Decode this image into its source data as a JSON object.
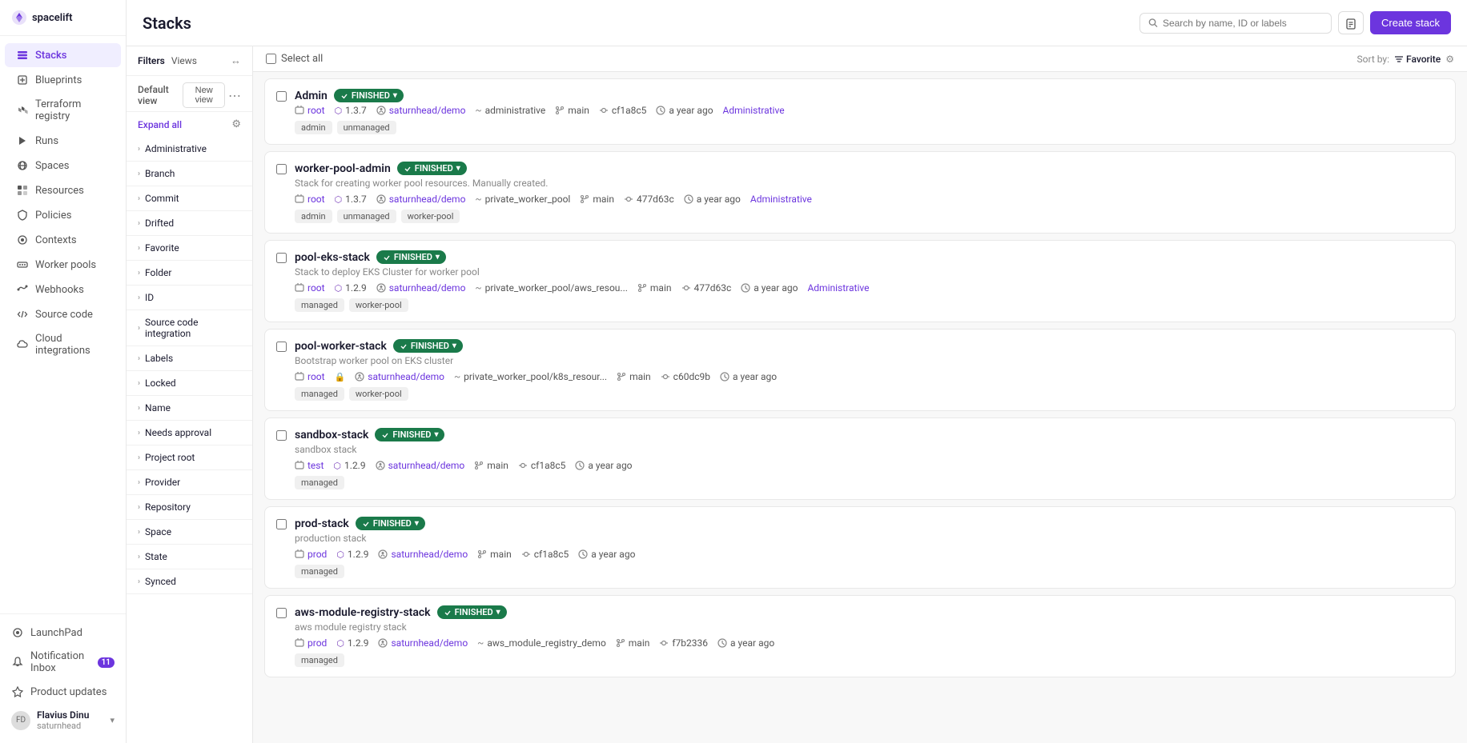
{
  "sidebar": {
    "logo": "spacelift",
    "nav_items": [
      {
        "id": "stacks",
        "label": "Stacks",
        "active": true
      },
      {
        "id": "blueprints",
        "label": "Blueprints"
      },
      {
        "id": "terraform",
        "label": "Terraform registry"
      },
      {
        "id": "runs",
        "label": "Runs"
      },
      {
        "id": "spaces",
        "label": "Spaces"
      },
      {
        "id": "resources",
        "label": "Resources"
      },
      {
        "id": "policies",
        "label": "Policies"
      },
      {
        "id": "contexts",
        "label": "Contexts"
      },
      {
        "id": "worker-pools",
        "label": "Worker pools"
      },
      {
        "id": "webhooks",
        "label": "Webhooks"
      },
      {
        "id": "source-code",
        "label": "Source code"
      },
      {
        "id": "cloud-integrations",
        "label": "Cloud integrations"
      }
    ],
    "bottom_items": [
      {
        "id": "launchpad",
        "label": "LaunchPad"
      },
      {
        "id": "notification-inbox",
        "label": "Notification Inbox",
        "badge": "11"
      },
      {
        "id": "product-updates",
        "label": "Product updates"
      }
    ],
    "user": {
      "name": "Flavius Dinu",
      "org": "saturnhead"
    }
  },
  "header": {
    "title": "Stacks",
    "search_placeholder": "Search by name, ID or labels",
    "create_button": "Create stack"
  },
  "filters": {
    "filters_label": "Filters",
    "views_label": "Views",
    "expand_all_label": "Expand all",
    "default_view": "Default view",
    "new_view_label": "New view",
    "filter_groups": [
      {
        "label": "Administrative"
      },
      {
        "label": "Branch"
      },
      {
        "label": "Commit"
      },
      {
        "label": "Drifted"
      },
      {
        "label": "Favorite"
      },
      {
        "label": "Folder"
      },
      {
        "label": "ID"
      },
      {
        "label": "Source code integration"
      },
      {
        "label": "Labels"
      },
      {
        "label": "Locked"
      },
      {
        "label": "Name"
      },
      {
        "label": "Needs approval"
      },
      {
        "label": "Project root"
      },
      {
        "label": "Provider"
      },
      {
        "label": "Repository"
      },
      {
        "label": "Space"
      },
      {
        "label": "State"
      },
      {
        "label": "Synced"
      }
    ]
  },
  "select_all": "Select all",
  "sort": {
    "label": "Sort by:",
    "value": "Favorite"
  },
  "stacks": [
    {
      "id": "admin",
      "name": "Admin",
      "description": "",
      "status": "FINISHED",
      "root": "root",
      "tf_version": "1.3.7",
      "repo": "saturnhead/demo",
      "path": "administrative",
      "branch": "main",
      "commit": "cf1a8c5",
      "time": "a year ago",
      "space": "Administrative",
      "tags": [
        "admin",
        "unmanaged"
      ]
    },
    {
      "id": "worker-pool-admin",
      "name": "worker-pool-admin",
      "description": "Stack for creating worker pool resources. Manually created.",
      "status": "FINISHED",
      "root": "root",
      "tf_version": "1.3.7",
      "repo": "saturnhead/demo",
      "path": "private_worker_pool",
      "branch": "main",
      "commit": "477d63c",
      "time": "a year ago",
      "space": "Administrative",
      "tags": [
        "admin",
        "unmanaged",
        "worker-pool"
      ]
    },
    {
      "id": "pool-eks-stack",
      "name": "pool-eks-stack",
      "description": "Stack to deploy EKS Cluster for worker pool",
      "status": "FINISHED",
      "root": "root",
      "tf_version": "1.2.9",
      "repo": "saturnhead/demo",
      "path": "private_worker_pool/aws_resou...",
      "branch": "main",
      "commit": "477d63c",
      "time": "a year ago",
      "space": "Administrative",
      "tags": [
        "managed",
        "worker-pool"
      ]
    },
    {
      "id": "pool-worker-stack",
      "name": "pool-worker-stack",
      "description": "Bootstrap worker pool on EKS cluster",
      "status": "FINISHED",
      "root": "root",
      "tf_version": "",
      "repo": "saturnhead/demo",
      "path": "private_worker_pool/k8s_resour...",
      "branch": "main",
      "commit": "c60dc9b",
      "time": "a year ago",
      "space": "",
      "tags": [
        "managed",
        "worker-pool"
      ]
    },
    {
      "id": "sandbox-stack",
      "name": "sandbox-stack",
      "description": "sandbox stack",
      "status": "FINISHED",
      "root": "test",
      "tf_version": "1.2.9",
      "repo": "saturnhead/demo",
      "path": "",
      "branch": "main",
      "commit": "cf1a8c5",
      "time": "a year ago",
      "space": "",
      "tags": [
        "managed"
      ]
    },
    {
      "id": "prod-stack",
      "name": "prod-stack",
      "description": "production stack",
      "status": "FINISHED",
      "root": "prod",
      "tf_version": "1.2.9",
      "repo": "saturnhead/demo",
      "path": "",
      "branch": "main",
      "commit": "cf1a8c5",
      "time": "a year ago",
      "space": "",
      "tags": [
        "managed"
      ]
    },
    {
      "id": "aws-module-registry-stack",
      "name": "aws-module-registry-stack",
      "description": "aws module registry stack",
      "status": "FINISHED",
      "root": "prod",
      "tf_version": "1.2.9",
      "repo": "saturnhead/demo",
      "path": "aws_module_registry_demo",
      "branch": "main",
      "commit": "f7b2336",
      "time": "a year ago",
      "space": "",
      "tags": [
        "managed"
      ]
    }
  ]
}
